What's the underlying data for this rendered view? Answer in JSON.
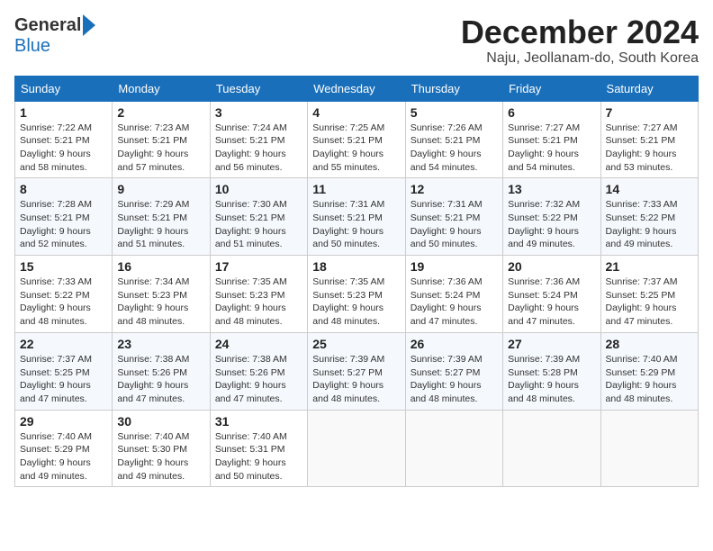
{
  "logo": {
    "general": "General",
    "blue": "Blue"
  },
  "header": {
    "month_title": "December 2024",
    "subtitle": "Naju, Jeollanam-do, South Korea"
  },
  "days_of_week": [
    "Sunday",
    "Monday",
    "Tuesday",
    "Wednesday",
    "Thursday",
    "Friday",
    "Saturday"
  ],
  "weeks": [
    [
      {
        "day": "1",
        "sunrise": "7:22 AM",
        "sunset": "5:21 PM",
        "daylight": "9 hours and 58 minutes."
      },
      {
        "day": "2",
        "sunrise": "7:23 AM",
        "sunset": "5:21 PM",
        "daylight": "9 hours and 57 minutes."
      },
      {
        "day": "3",
        "sunrise": "7:24 AM",
        "sunset": "5:21 PM",
        "daylight": "9 hours and 56 minutes."
      },
      {
        "day": "4",
        "sunrise": "7:25 AM",
        "sunset": "5:21 PM",
        "daylight": "9 hours and 55 minutes."
      },
      {
        "day": "5",
        "sunrise": "7:26 AM",
        "sunset": "5:21 PM",
        "daylight": "9 hours and 54 minutes."
      },
      {
        "day": "6",
        "sunrise": "7:27 AM",
        "sunset": "5:21 PM",
        "daylight": "9 hours and 54 minutes."
      },
      {
        "day": "7",
        "sunrise": "7:27 AM",
        "sunset": "5:21 PM",
        "daylight": "9 hours and 53 minutes."
      }
    ],
    [
      {
        "day": "8",
        "sunrise": "7:28 AM",
        "sunset": "5:21 PM",
        "daylight": "9 hours and 52 minutes."
      },
      {
        "day": "9",
        "sunrise": "7:29 AM",
        "sunset": "5:21 PM",
        "daylight": "9 hours and 51 minutes."
      },
      {
        "day": "10",
        "sunrise": "7:30 AM",
        "sunset": "5:21 PM",
        "daylight": "9 hours and 51 minutes."
      },
      {
        "day": "11",
        "sunrise": "7:31 AM",
        "sunset": "5:21 PM",
        "daylight": "9 hours and 50 minutes."
      },
      {
        "day": "12",
        "sunrise": "7:31 AM",
        "sunset": "5:21 PM",
        "daylight": "9 hours and 50 minutes."
      },
      {
        "day": "13",
        "sunrise": "7:32 AM",
        "sunset": "5:22 PM",
        "daylight": "9 hours and 49 minutes."
      },
      {
        "day": "14",
        "sunrise": "7:33 AM",
        "sunset": "5:22 PM",
        "daylight": "9 hours and 49 minutes."
      }
    ],
    [
      {
        "day": "15",
        "sunrise": "7:33 AM",
        "sunset": "5:22 PM",
        "daylight": "9 hours and 48 minutes."
      },
      {
        "day": "16",
        "sunrise": "7:34 AM",
        "sunset": "5:23 PM",
        "daylight": "9 hours and 48 minutes."
      },
      {
        "day": "17",
        "sunrise": "7:35 AM",
        "sunset": "5:23 PM",
        "daylight": "9 hours and 48 minutes."
      },
      {
        "day": "18",
        "sunrise": "7:35 AM",
        "sunset": "5:23 PM",
        "daylight": "9 hours and 48 minutes."
      },
      {
        "day": "19",
        "sunrise": "7:36 AM",
        "sunset": "5:24 PM",
        "daylight": "9 hours and 47 minutes."
      },
      {
        "day": "20",
        "sunrise": "7:36 AM",
        "sunset": "5:24 PM",
        "daylight": "9 hours and 47 minutes."
      },
      {
        "day": "21",
        "sunrise": "7:37 AM",
        "sunset": "5:25 PM",
        "daylight": "9 hours and 47 minutes."
      }
    ],
    [
      {
        "day": "22",
        "sunrise": "7:37 AM",
        "sunset": "5:25 PM",
        "daylight": "9 hours and 47 minutes."
      },
      {
        "day": "23",
        "sunrise": "7:38 AM",
        "sunset": "5:26 PM",
        "daylight": "9 hours and 47 minutes."
      },
      {
        "day": "24",
        "sunrise": "7:38 AM",
        "sunset": "5:26 PM",
        "daylight": "9 hours and 47 minutes."
      },
      {
        "day": "25",
        "sunrise": "7:39 AM",
        "sunset": "5:27 PM",
        "daylight": "9 hours and 48 minutes."
      },
      {
        "day": "26",
        "sunrise": "7:39 AM",
        "sunset": "5:27 PM",
        "daylight": "9 hours and 48 minutes."
      },
      {
        "day": "27",
        "sunrise": "7:39 AM",
        "sunset": "5:28 PM",
        "daylight": "9 hours and 48 minutes."
      },
      {
        "day": "28",
        "sunrise": "7:40 AM",
        "sunset": "5:29 PM",
        "daylight": "9 hours and 48 minutes."
      }
    ],
    [
      {
        "day": "29",
        "sunrise": "7:40 AM",
        "sunset": "5:29 PM",
        "daylight": "9 hours and 49 minutes."
      },
      {
        "day": "30",
        "sunrise": "7:40 AM",
        "sunset": "5:30 PM",
        "daylight": "9 hours and 49 minutes."
      },
      {
        "day": "31",
        "sunrise": "7:40 AM",
        "sunset": "5:31 PM",
        "daylight": "9 hours and 50 minutes."
      },
      null,
      null,
      null,
      null
    ]
  ],
  "labels": {
    "sunrise": "Sunrise:",
    "sunset": "Sunset:",
    "daylight": "Daylight:"
  }
}
